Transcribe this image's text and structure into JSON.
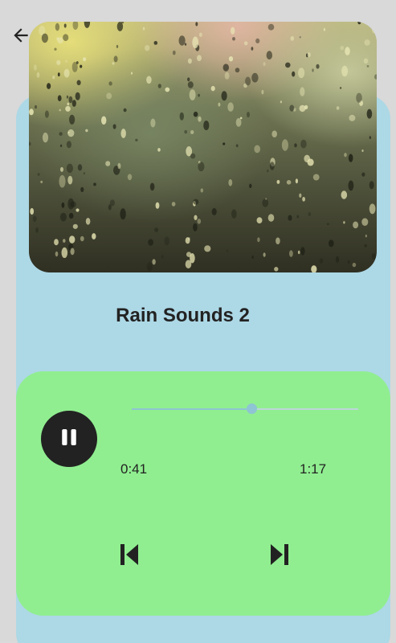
{
  "header": {
    "back_icon": "arrow-left-icon"
  },
  "artwork": {
    "image": "rain-on-window"
  },
  "track": {
    "title": "Rain Sounds 2"
  },
  "player": {
    "play_pause_icon": "pause-icon",
    "elapsed": "0:41",
    "total": "1:17",
    "progress_fraction": 0.53,
    "previous_icon": "skip-previous-icon",
    "next_icon": "skip-next-icon"
  },
  "colors": {
    "background": "#d9d9d9",
    "card_blue": "#add8e6",
    "card_green": "#90ee90",
    "dark": "#222222",
    "slider_accent": "#8ec4d3"
  }
}
